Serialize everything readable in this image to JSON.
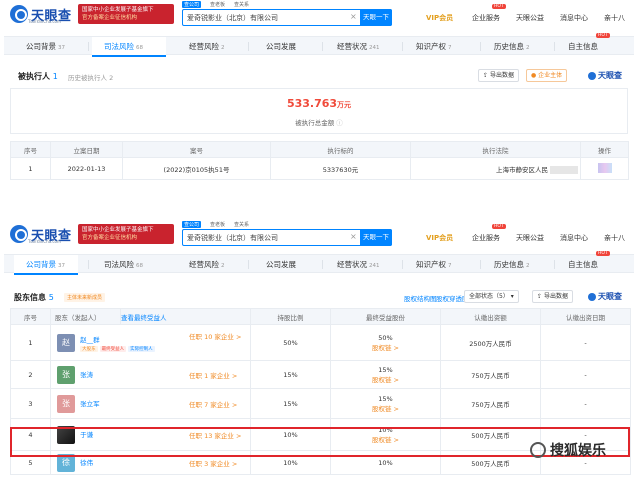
{
  "brand": {
    "logo": "天眼查",
    "logo_sub": "TianYanCha.com",
    "banner_line1": "国家中小企业发展子基金旗下",
    "banner_line2": "官方备案企业征信机构"
  },
  "search": {
    "tabs": [
      "查公司",
      "查老板",
      "查关系"
    ],
    "value": "爱奇锐影业（北京）有限公司",
    "button": "天眼一下",
    "clear": "×"
  },
  "topnav": {
    "vip": "VIP会员",
    "hot": "HOT",
    "items": [
      "企业服务",
      "天眼公益",
      "消息中心",
      "亲十八"
    ]
  },
  "panel1": {
    "tabs": [
      {
        "label": "公司背景",
        "count": "37"
      },
      {
        "label": "司法风险",
        "count": "68"
      },
      {
        "label": "经营风险",
        "count": "2"
      },
      {
        "label": "公司发展",
        "count": ""
      },
      {
        "label": "经营状况",
        "count": "241"
      },
      {
        "label": "知识产权",
        "count": "7"
      },
      {
        "label": "历史信息",
        "count": "2"
      },
      {
        "label": "自主信息",
        "count": ""
      }
    ],
    "hot": "HOT",
    "section_title": "被执行人",
    "section_count": "1",
    "history_link": "历史被执行人 2",
    "export_btn": "导出数据",
    "follow_btn": "企业主体",
    "tyc": "天眼查",
    "amount": "533.763",
    "amount_unit": "万元",
    "amount_label": "被执行总金额",
    "columns": [
      "序号",
      "立案日期",
      "案号",
      "执行标的",
      "执行法院",
      "操作"
    ],
    "row": {
      "no": "1",
      "date": "2022-01-13",
      "case": "(2022)京0105执51号",
      "amount": "5337630元",
      "court": "上海市静安区人民"
    }
  },
  "panel2": {
    "tabs": [
      {
        "label": "公司背景",
        "count": "37"
      },
      {
        "label": "司法风险",
        "count": "68"
      },
      {
        "label": "经营风险",
        "count": "2"
      },
      {
        "label": "公司发展",
        "count": ""
      },
      {
        "label": "经营状况",
        "count": "241"
      },
      {
        "label": "知识产权",
        "count": "7"
      },
      {
        "label": "历史信息",
        "count": "2"
      },
      {
        "label": "自主信息",
        "count": ""
      }
    ],
    "hot": "HOT",
    "section_title": "股东信息",
    "section_count": "5",
    "badge": "主体未来新成员",
    "graph_link": "股权结构图",
    "graph_link2": "股权穿透图",
    "filter": "全部状态（5）",
    "export_btn": "导出数据",
    "tyc": "天眼查",
    "columns": [
      "序号",
      "股东（发起人）",
      "查看最终受益人",
      "持股比例",
      "最终受益股份",
      "认缴出资额",
      "认缴出资日期"
    ],
    "rows": [
      {
        "no": "1",
        "avatar": "赵",
        "avatar_color": "#7d8fb3",
        "name": "赵__群",
        "tags": [
          "大股东",
          "最终受益人",
          "实际控制人"
        ],
        "related": "任职 10 家企业 >",
        "ratio": "50%",
        "benefit": "50%",
        "benefit_link": "股权链 >",
        "capital": "2500万人民币",
        "date": "-"
      },
      {
        "no": "2",
        "avatar": "张",
        "avatar_color": "#5fa06e",
        "name": "张涛",
        "tags": [],
        "related": "任职 1 家企业 >",
        "ratio": "15%",
        "benefit": "15%",
        "benefit_link": "股权链 >",
        "capital": "750万人民币",
        "date": "-"
      },
      {
        "no": "3",
        "avatar": "张",
        "avatar_color": "#e09a9a",
        "name": "张立军",
        "tags": [],
        "related": "任职 7 家企业 >",
        "ratio": "15%",
        "benefit": "15%",
        "benefit_link": "股权链 >",
        "capital": "750万人民币",
        "date": "-"
      },
      {
        "no": "4",
        "avatar": "",
        "avatar_color": "#222222",
        "name": "于谦",
        "tags": [],
        "related": "任职 13 家企业 >",
        "ratio": "10%",
        "benefit": "10%",
        "benefit_link": "股权链 >",
        "capital": "500万人民币",
        "date": "-"
      },
      {
        "no": "5",
        "avatar": "徐",
        "avatar_color": "#62b3d8",
        "name": "徐伟",
        "tags": [],
        "related": "任职 3 家企业 >",
        "ratio": "10%",
        "benefit": "10%",
        "benefit_link": "股权链 >",
        "capital": "500万人民币",
        "date": "-"
      }
    ]
  },
  "watermark": "搜狐娱乐",
  "colors": {
    "accent": "#0084ff",
    "danger": "#f04a3a",
    "highlight": "#e0252b"
  }
}
